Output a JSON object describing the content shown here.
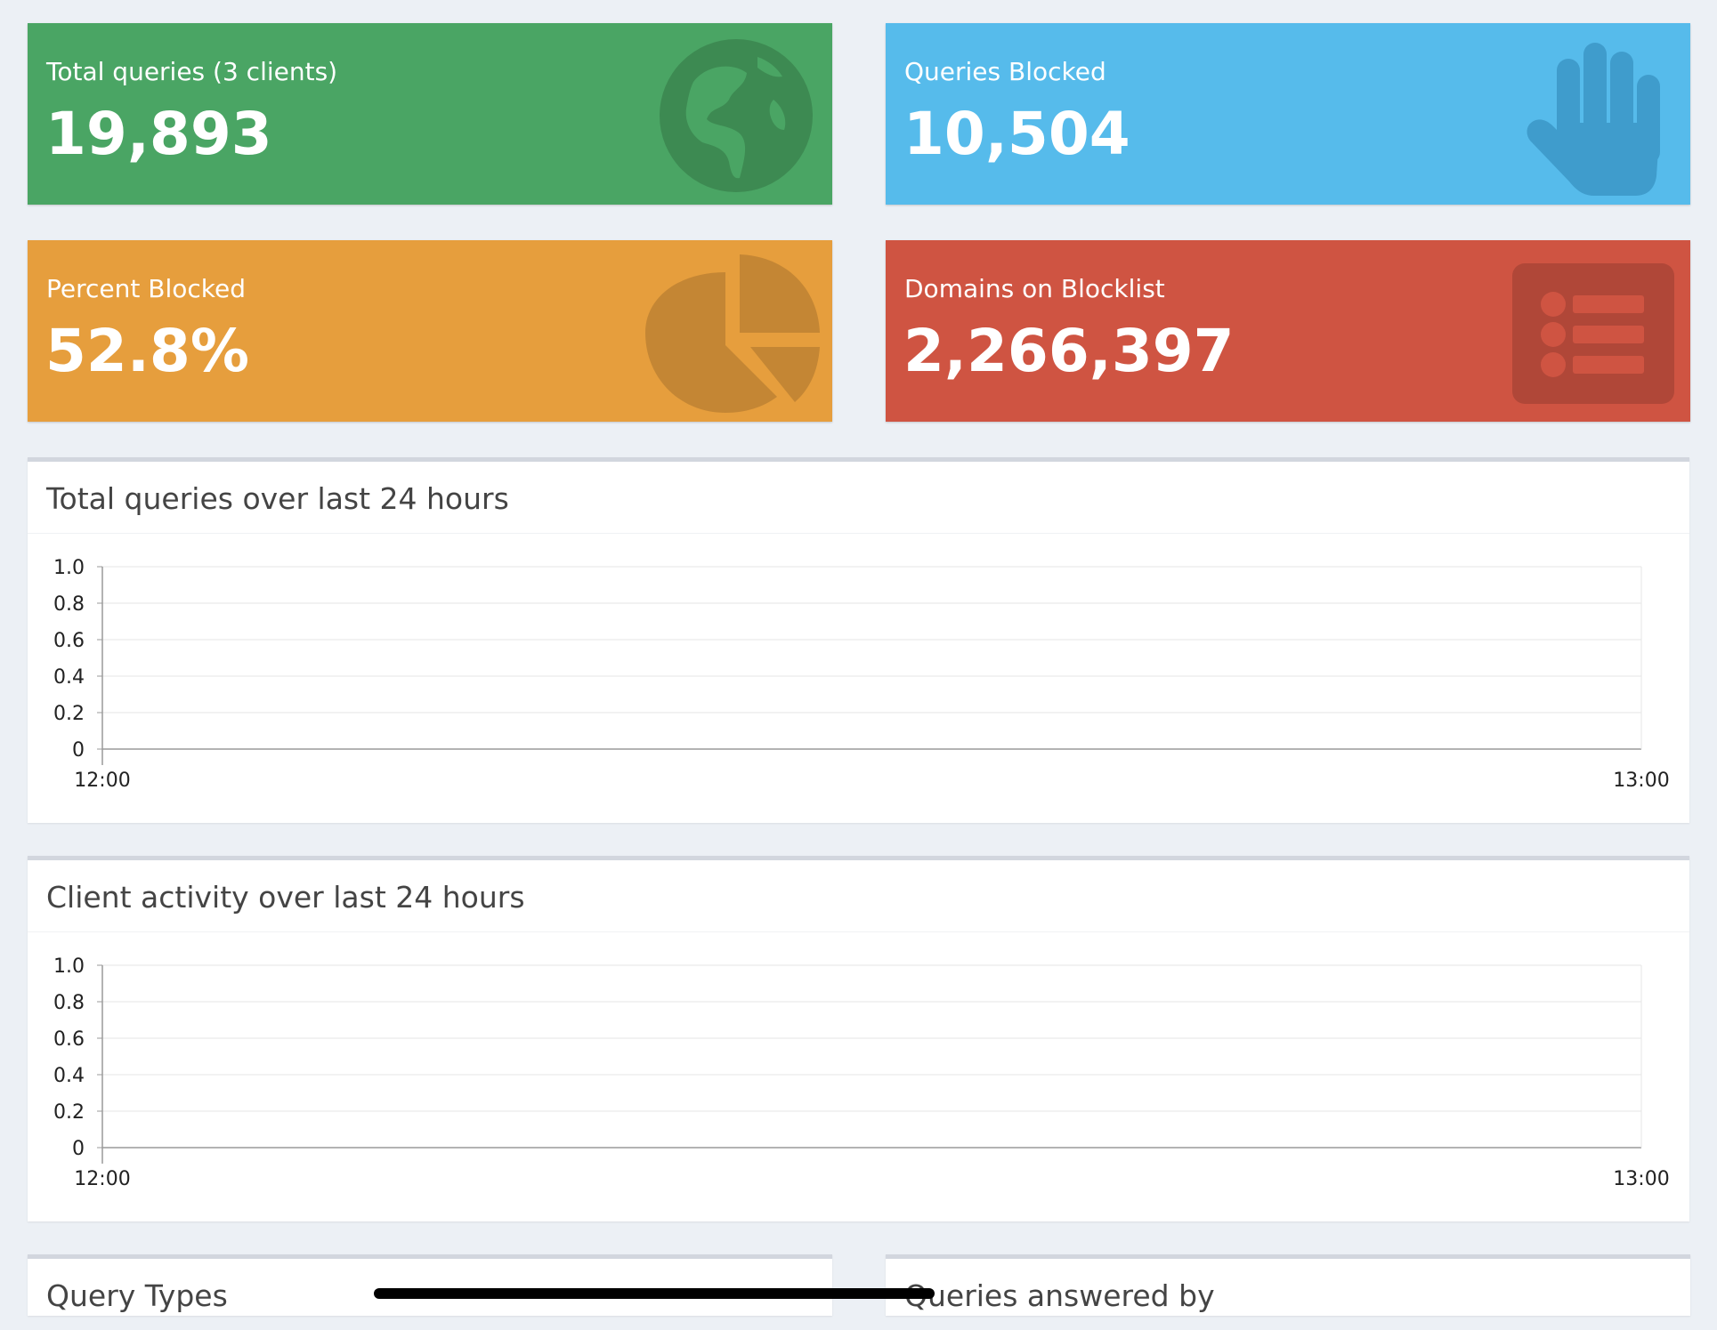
{
  "tiles": {
    "total_queries": {
      "label": "Total queries (3 clients)",
      "value": "19,893",
      "icon": "globe-icon",
      "color": "#4aa564"
    },
    "queries_blocked": {
      "label": "Queries Blocked",
      "value": "10,504",
      "icon": "hand-icon",
      "color": "#56bbeb"
    },
    "percent_blocked": {
      "label": "Percent Blocked",
      "value": "52.8%",
      "icon": "pie-chart-icon",
      "color": "#e69e3d"
    },
    "domains_blocklist": {
      "label": "Domains on Blocklist",
      "value": "2,266,397",
      "icon": "list-icon",
      "color": "#cf5442"
    }
  },
  "panels": {
    "total_queries_chart": {
      "title": "Total queries over last 24 hours"
    },
    "client_activity_chart": {
      "title": "Client activity over last 24 hours"
    },
    "query_types": {
      "title": "Query Types"
    },
    "queries_answered_by": {
      "title": "Queries answered by"
    }
  },
  "chart_data": [
    {
      "type": "line",
      "x": [
        "12:00",
        "13:00"
      ],
      "yticks": [
        "1.0",
        "0.8",
        "0.6",
        "0.4",
        "0.2",
        "0"
      ],
      "ylim": [
        0,
        1
      ],
      "series": [],
      "grid": true
    },
    {
      "type": "line",
      "x": [
        "12:00",
        "13:00"
      ],
      "yticks": [
        "1.0",
        "0.8",
        "0.6",
        "0.4",
        "0.2",
        "0"
      ],
      "ylim": [
        0,
        1
      ],
      "series": [],
      "grid": true
    }
  ]
}
